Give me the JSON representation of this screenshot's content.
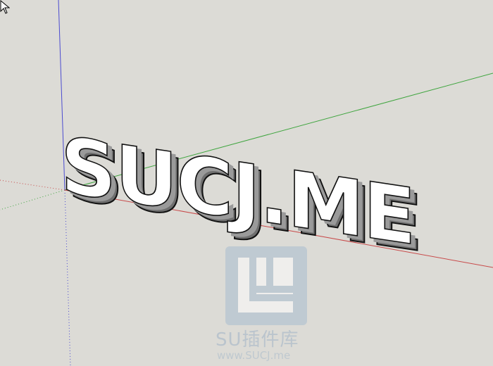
{
  "viewport": {
    "background": "#dcdbd6",
    "axis_colors": {
      "red": "#c84a4a",
      "green": "#3fa53f",
      "blue": "#4b4bd0"
    }
  },
  "model": {
    "text": "SUCJ.ME",
    "face_color": "#ffffff",
    "side_color": "#8e8e8e",
    "edge_color": "#111111"
  },
  "watermark": {
    "title": "SU插件库",
    "url": "www.SUCJ.me",
    "color": "#a9bdd0"
  },
  "cursor": {
    "icon": "arrow-cursor-icon"
  }
}
